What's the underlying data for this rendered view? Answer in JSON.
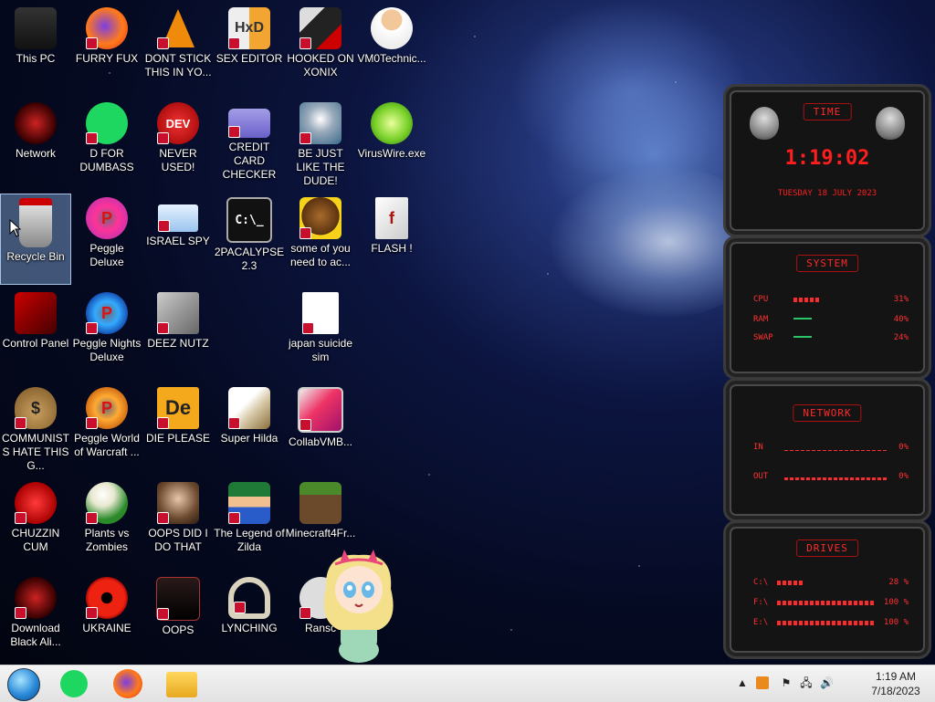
{
  "desktop": {
    "icons": [
      {
        "label": "This PC"
      },
      {
        "label": "FURRY FUX"
      },
      {
        "label": "DONT STICK THIS IN YO..."
      },
      {
        "label": "SEX EDITOR"
      },
      {
        "label": "HOOKED ON XONIX"
      },
      {
        "label": "VM0Technic..."
      },
      {
        "label": "Network"
      },
      {
        "label": "D FOR DUMBASS"
      },
      {
        "label": "NEVER USED!"
      },
      {
        "label": "CREDIT CARD CHECKER"
      },
      {
        "label": "BE JUST LIKE THE DUDE!"
      },
      {
        "label": "VirusWire.exe"
      },
      {
        "label": "Recycle Bin"
      },
      {
        "label": "Peggle Deluxe"
      },
      {
        "label": "ISRAEL SPY"
      },
      {
        "label": "2PACALYPSE 2.3"
      },
      {
        "label": "some of you need to ac..."
      },
      {
        "label": "FLASH !"
      },
      {
        "label": "Control Panel"
      },
      {
        "label": "Peggle Nights Deluxe"
      },
      {
        "label": "DEEZ NUTZ"
      },
      {
        "label": "japan suicide sim"
      },
      {
        "label": "COMMUNISTS HATE THIS G..."
      },
      {
        "label": "Peggle World of Warcraft ..."
      },
      {
        "label": "DIE PLEASE"
      },
      {
        "label": "Super Hilda"
      },
      {
        "label": "CollabVMB..."
      },
      {
        "label": "CHUZZIN CUM"
      },
      {
        "label": "Plants vs Zombies"
      },
      {
        "label": "OOPS DID I DO THAT"
      },
      {
        "label": "The Legend of Zilda"
      },
      {
        "label": "Minecraft4Fr..."
      },
      {
        "label": "Download Black Ali..."
      },
      {
        "label": "UKRAINE"
      },
      {
        "label": "OOPS"
      },
      {
        "label": "LYNCHING"
      },
      {
        "label": "Ransc"
      }
    ]
  },
  "widget": {
    "time": {
      "title": "TIME",
      "clock": "1:19:02",
      "date": "TUESDAY 18 JULY 2023"
    },
    "system": {
      "title": "SYSTEM",
      "rows": [
        {
          "key": "CPU",
          "value": "31%"
        },
        {
          "key": "RAM",
          "value": "40%"
        },
        {
          "key": "SWAP",
          "value": "24%"
        }
      ]
    },
    "network": {
      "title": "NETWORK",
      "rows": [
        {
          "key": "IN",
          "value": "0%"
        },
        {
          "key": "OUT",
          "value": "0%"
        }
      ]
    },
    "drives": {
      "title": "DRIVES",
      "rows": [
        {
          "key": "C:\\",
          "value": "28 %"
        },
        {
          "key": "F:\\",
          "value": "100 %"
        },
        {
          "key": "E:\\",
          "value": "100 %"
        }
      ]
    }
  },
  "taskbar": {
    "clock_time": "1:19 AM",
    "clock_date": "7/18/2023"
  }
}
